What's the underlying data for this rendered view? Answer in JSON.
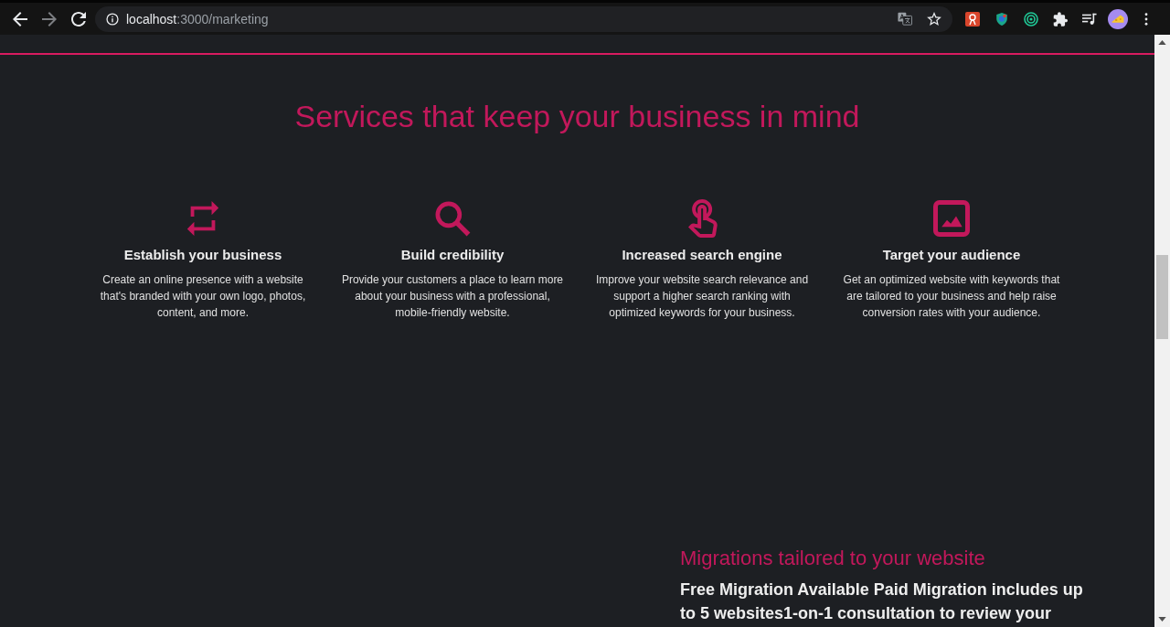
{
  "browser": {
    "address": {
      "host": "localhost",
      "path": ":3000/marketing"
    }
  },
  "services": {
    "title": "Services that keep your business in mind",
    "features": [
      {
        "title": "Establish your business",
        "description": "Create an online presence with a website that's branded with your own logo, photos, content, and more."
      },
      {
        "title": "Build credibility",
        "description": "Provide your customers a place to learn more about your business with a professional, mobile-friendly website."
      },
      {
        "title": "Increased search engine",
        "description": "Improve your website search relevance and support a higher search ranking with optimized keywords for your business."
      },
      {
        "title": "Target your audience",
        "description": "Get an optimized website with keywords that are tailored to your business and help raise conversion rates with your audience."
      }
    ]
  },
  "migrations": {
    "title": "Migrations tailored to your website",
    "text": "Free Migration Available Paid Migration includes up to 5 websites1-on-1 consultation to review your"
  }
}
